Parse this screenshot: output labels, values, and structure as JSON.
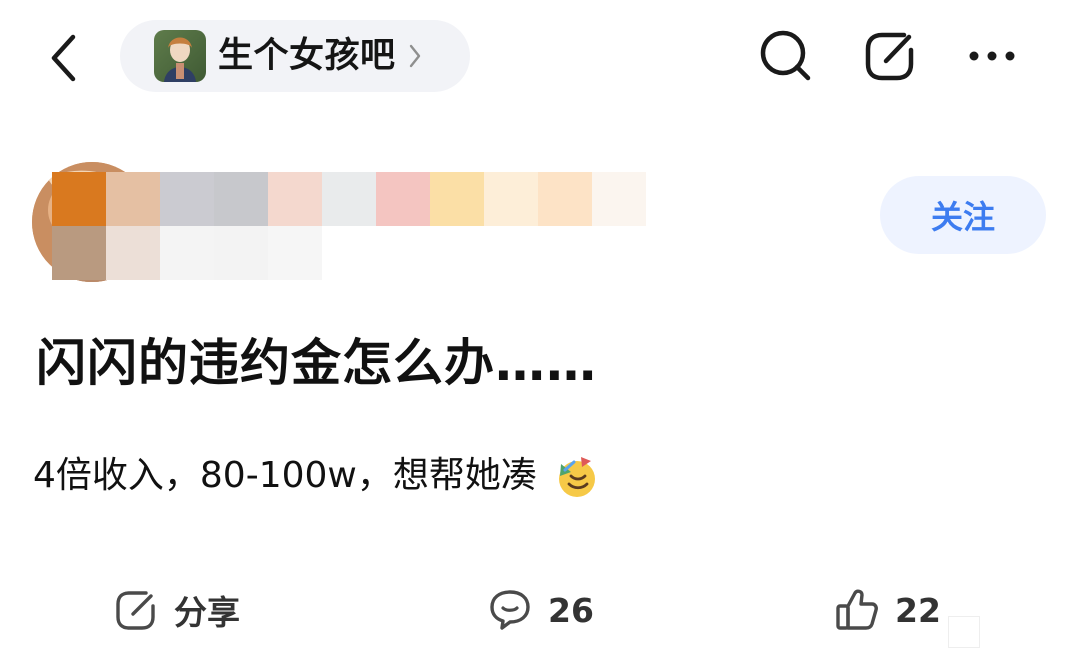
{
  "forum": {
    "name": "生个女孩吧"
  },
  "author": {
    "follow_label": "关注"
  },
  "post": {
    "title": "闪闪的违约金怎么办……",
    "body": "4倍收入，80-100w，想帮她凑"
  },
  "actions": {
    "share_label": "分享",
    "comment_count": "26",
    "like_count": "22"
  },
  "icons": {
    "back": "chevron-left-icon",
    "search": "search-icon",
    "edit": "compose-icon",
    "more": "more-horizontal-icon",
    "share": "share-icon",
    "comment": "comment-icon",
    "like": "thumbs-up-icon"
  },
  "colors": {
    "accent": "#3d7cf0",
    "pill_bg": "#f2f3f7",
    "follow_bg": "#eef3ff"
  }
}
